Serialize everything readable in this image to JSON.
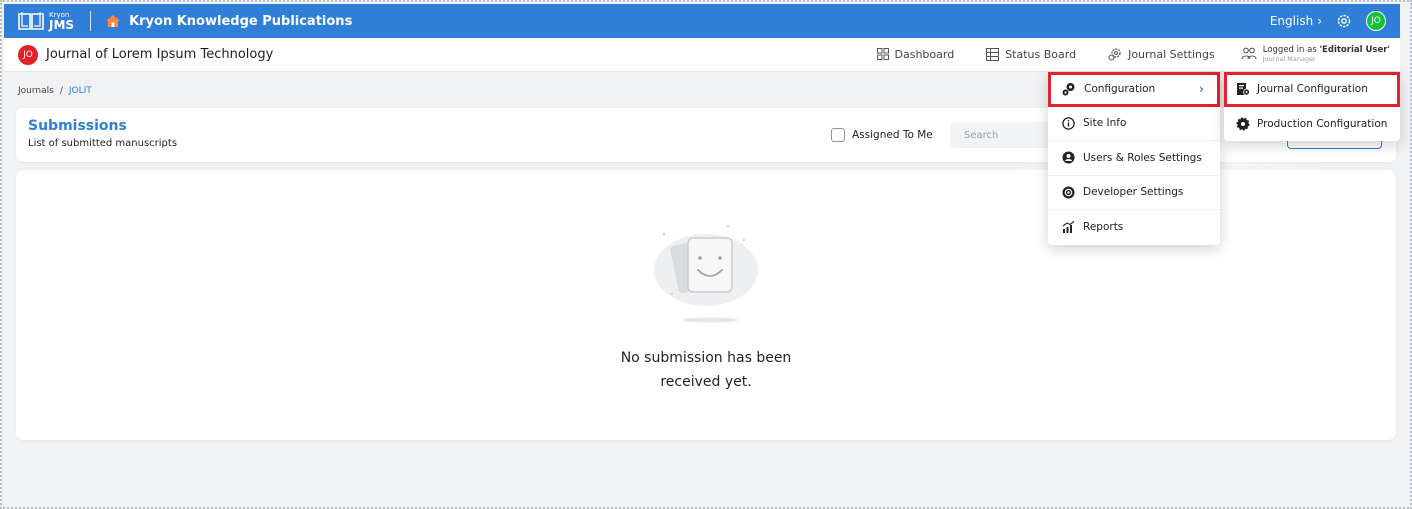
{
  "topbar": {
    "logo_small": "Kryon",
    "logo_big": "JMS",
    "org_name": "Kryon Knowledge Publications",
    "language": "English",
    "avatar_initials": "JO"
  },
  "header": {
    "journal_badge": "JO",
    "journal_name": "Journal of Lorem Ipsum Technology",
    "nav": {
      "dashboard": "Dashboard",
      "status_board": "Status Board",
      "journal_settings": "Journal Settings"
    },
    "user": {
      "logged_prefix": "Logged in as ",
      "user_name": "'Editorial User'",
      "role": "Journal Manager"
    }
  },
  "breadcrumb": {
    "root": "Journals",
    "separator": "/",
    "current": "JOLIT"
  },
  "submissions": {
    "title": "Submissions",
    "description": "List of submitted manuscripts",
    "assigned_label": "Assigned To Me",
    "search_placeholder": "Search"
  },
  "empty_state": {
    "line1": "No submission has been",
    "line2": "received yet."
  },
  "settings_menu": {
    "items": [
      {
        "label": "Configuration",
        "icon": "gears-icon",
        "chevron": "›"
      },
      {
        "label": "Site Info",
        "icon": "info-icon"
      },
      {
        "label": "Users & Roles Settings",
        "icon": "user-settings-icon"
      },
      {
        "label": "Developer Settings",
        "icon": "developer-gear-icon"
      },
      {
        "label": "Reports",
        "icon": "reports-icon"
      }
    ]
  },
  "configuration_submenu": {
    "items": [
      {
        "label": "Journal Configuration",
        "icon": "journal-config-icon"
      },
      {
        "label": "Production Configuration",
        "icon": "production-gear-icon"
      }
    ]
  },
  "colors": {
    "primary": "#2f7fd8",
    "highlight": "#e0232f",
    "avatar_green": "#16c23a",
    "journal_red": "#e3202a"
  }
}
